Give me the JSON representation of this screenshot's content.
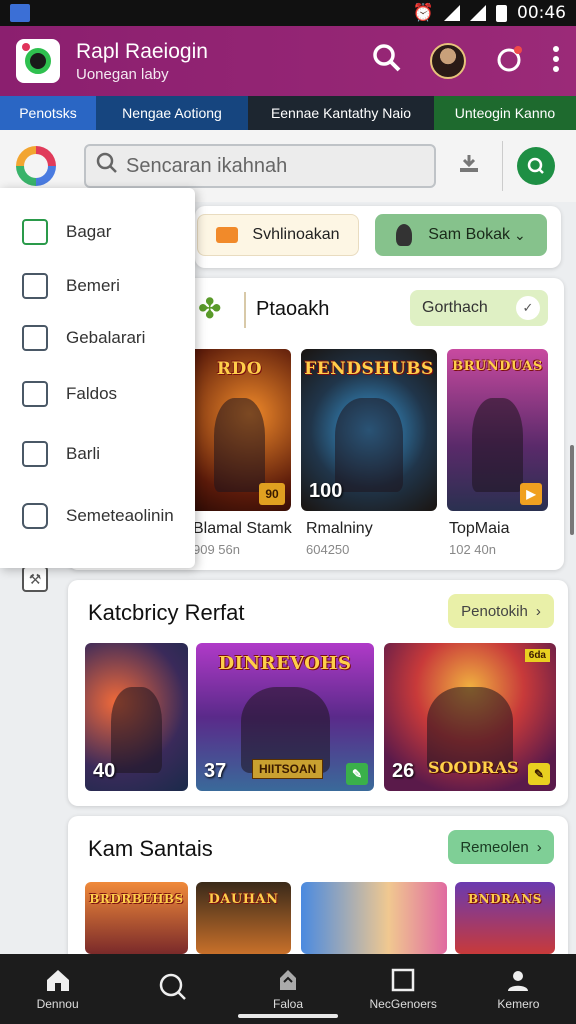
{
  "status": {
    "time": "00:46"
  },
  "app": {
    "title": "Rapl Raeiogin",
    "subtitle": "Uonegan laby"
  },
  "tabs": [
    "Penotsks",
    "Nengae Aotiong",
    "Eennae Kantathy Naio",
    "Unteogin Kanno"
  ],
  "search": {
    "placeholder": "Sencaran ikahnah"
  },
  "drawer": {
    "items": [
      "Bagar",
      "Bemeri",
      "Gebalarari",
      "Faldos",
      "Barli",
      "Semeteaolinin"
    ]
  },
  "filters": {
    "primary": "Svhlinoakan",
    "secondary": "Sam Bokak"
  },
  "featured": {
    "title": "Ptaoakh",
    "action": "Gorthach",
    "games": [
      {
        "logo": "RDO",
        "num": "",
        "badge": "90",
        "name": "Blamal Stamk",
        "meta": "909 56n"
      },
      {
        "logo": "FENDSHUBS",
        "num": "100",
        "badge": "",
        "name": "Rmalniny",
        "meta": "604250"
      },
      {
        "logo": "BRUNDUAS",
        "num": "",
        "badge": "▶",
        "name": "TopMaia",
        "meta": "102 40n"
      }
    ]
  },
  "section2": {
    "title": "Katcbricy Rerfat",
    "action": "Penotokih",
    "games": [
      {
        "logo": "",
        "num": "40"
      },
      {
        "logo": "DINREVOHS",
        "num": "37",
        "banner": "HIITSOAN"
      },
      {
        "logo": "",
        "num": "26",
        "banner": "SOODRAS",
        "corner": "6da"
      }
    ]
  },
  "section3": {
    "title": "Kam Santais",
    "action": "Remeolen",
    "games": [
      {
        "logo": "BRDRBEHBS"
      },
      {
        "logo": "DAUHAN"
      },
      {
        "logo": ""
      },
      {
        "logo": "BNDRANS"
      }
    ]
  },
  "bottom_nav": [
    "Dennou",
    "",
    "Faloa",
    "NecGenoers",
    "Kemero"
  ],
  "colors": {
    "appbar": "#8b1f6f",
    "accent_green": "#1e8f44",
    "chip_green": "#dff0c4"
  }
}
